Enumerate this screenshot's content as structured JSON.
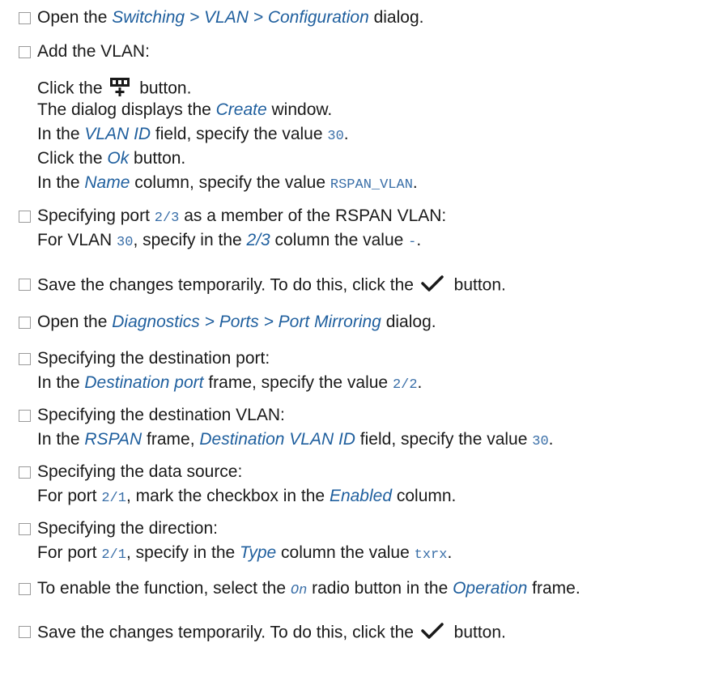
{
  "steps": [
    {
      "parts": [
        {
          "t": "text",
          "v": "Open the "
        },
        {
          "t": "em",
          "v": "Switching > VLAN > Configuration"
        },
        {
          "t": "text",
          "v": " dialog."
        }
      ]
    },
    {
      "lines": [
        [
          {
            "t": "text",
            "v": "Add the VLAN:"
          }
        ],
        [
          {
            "t": "text",
            "v": "Click the "
          },
          {
            "t": "icon",
            "v": "add-table-row-icon"
          },
          {
            "t": "text",
            "v": " button."
          }
        ],
        [
          {
            "t": "text",
            "v": "The dialog displays the "
          },
          {
            "t": "em",
            "v": "Create"
          },
          {
            "t": "text",
            "v": " window."
          }
        ],
        [
          {
            "t": "text",
            "v": "In the "
          },
          {
            "t": "em",
            "v": "VLAN ID"
          },
          {
            "t": "text",
            "v": " field, specify the value "
          },
          {
            "t": "code",
            "v": "30"
          },
          {
            "t": "text",
            "v": "."
          }
        ],
        [
          {
            "t": "text",
            "v": "Click the "
          },
          {
            "t": "em",
            "v": "Ok"
          },
          {
            "t": "text",
            "v": " button."
          }
        ],
        [
          {
            "t": "text",
            "v": "In the "
          },
          {
            "t": "em",
            "v": "Name"
          },
          {
            "t": "text",
            "v": " column, specify the value "
          },
          {
            "t": "code",
            "v": "RSPAN_VLAN"
          },
          {
            "t": "text",
            "v": "."
          }
        ]
      ]
    },
    {
      "lines": [
        [
          {
            "t": "text",
            "v": "Specifying port "
          },
          {
            "t": "code",
            "v": "2/3"
          },
          {
            "t": "text",
            "v": " as a member of the RSPAN VLAN:"
          }
        ],
        [
          {
            "t": "text",
            "v": "For VLAN "
          },
          {
            "t": "code",
            "v": "30"
          },
          {
            "t": "text",
            "v": ", specify in the "
          },
          {
            "t": "em",
            "v": "2/3"
          },
          {
            "t": "text",
            "v": " column the value "
          },
          {
            "t": "code",
            "v": "-"
          },
          {
            "t": "text",
            "v": "."
          }
        ]
      ]
    },
    {
      "parts": [
        {
          "t": "text",
          "v": "Save the changes temporarily. To do this, click the "
        },
        {
          "t": "icon",
          "v": "checkmark-icon"
        },
        {
          "t": "text",
          "v": " button."
        }
      ]
    },
    {
      "parts": [
        {
          "t": "text",
          "v": "Open the "
        },
        {
          "t": "em",
          "v": "Diagnostics > Ports > Port Mirroring"
        },
        {
          "t": "text",
          "v": " dialog."
        }
      ]
    },
    {
      "lines": [
        [
          {
            "t": "text",
            "v": "Specifying the destination port:"
          }
        ],
        [
          {
            "t": "text",
            "v": "In the "
          },
          {
            "t": "em",
            "v": "Destination port"
          },
          {
            "t": "text",
            "v": " frame, specify the value "
          },
          {
            "t": "code",
            "v": "2/2"
          },
          {
            "t": "text",
            "v": "."
          }
        ]
      ]
    },
    {
      "lines": [
        [
          {
            "t": "text",
            "v": "Specifying the destination VLAN:"
          }
        ],
        [
          {
            "t": "text",
            "v": "In the "
          },
          {
            "t": "em",
            "v": "RSPAN"
          },
          {
            "t": "text",
            "v": " frame, "
          },
          {
            "t": "em",
            "v": "Destination VLAN ID"
          },
          {
            "t": "text",
            "v": " field, specify the value "
          },
          {
            "t": "code",
            "v": "30"
          },
          {
            "t": "text",
            "v": "."
          }
        ]
      ]
    },
    {
      "lines": [
        [
          {
            "t": "text",
            "v": "Specifying the data source:"
          }
        ],
        [
          {
            "t": "text",
            "v": "For port "
          },
          {
            "t": "code",
            "v": "2/1"
          },
          {
            "t": "text",
            "v": ", mark the checkbox in the "
          },
          {
            "t": "em",
            "v": "Enabled"
          },
          {
            "t": "text",
            "v": " column."
          }
        ]
      ]
    },
    {
      "lines": [
        [
          {
            "t": "text",
            "v": "Specifying the direction:"
          }
        ],
        [
          {
            "t": "text",
            "v": "For port "
          },
          {
            "t": "code",
            "v": "2/1"
          },
          {
            "t": "text",
            "v": ", specify in the "
          },
          {
            "t": "em",
            "v": "Type"
          },
          {
            "t": "text",
            "v": " column the value "
          },
          {
            "t": "code",
            "v": "txrx"
          },
          {
            "t": "text",
            "v": "."
          }
        ]
      ]
    },
    {
      "parts": [
        {
          "t": "text",
          "v": "To enable the function, select the "
        },
        {
          "t": "codeit",
          "v": "On"
        },
        {
          "t": "text",
          "v": " radio button in the "
        },
        {
          "t": "em",
          "v": "Operation"
        },
        {
          "t": "text",
          "v": " frame."
        }
      ]
    },
    {
      "parts": [
        {
          "t": "text",
          "v": "Save the changes temporarily. To do this, click the "
        },
        {
          "t": "icon",
          "v": "checkmark-icon"
        },
        {
          "t": "text",
          "v": " button."
        }
      ]
    }
  ]
}
